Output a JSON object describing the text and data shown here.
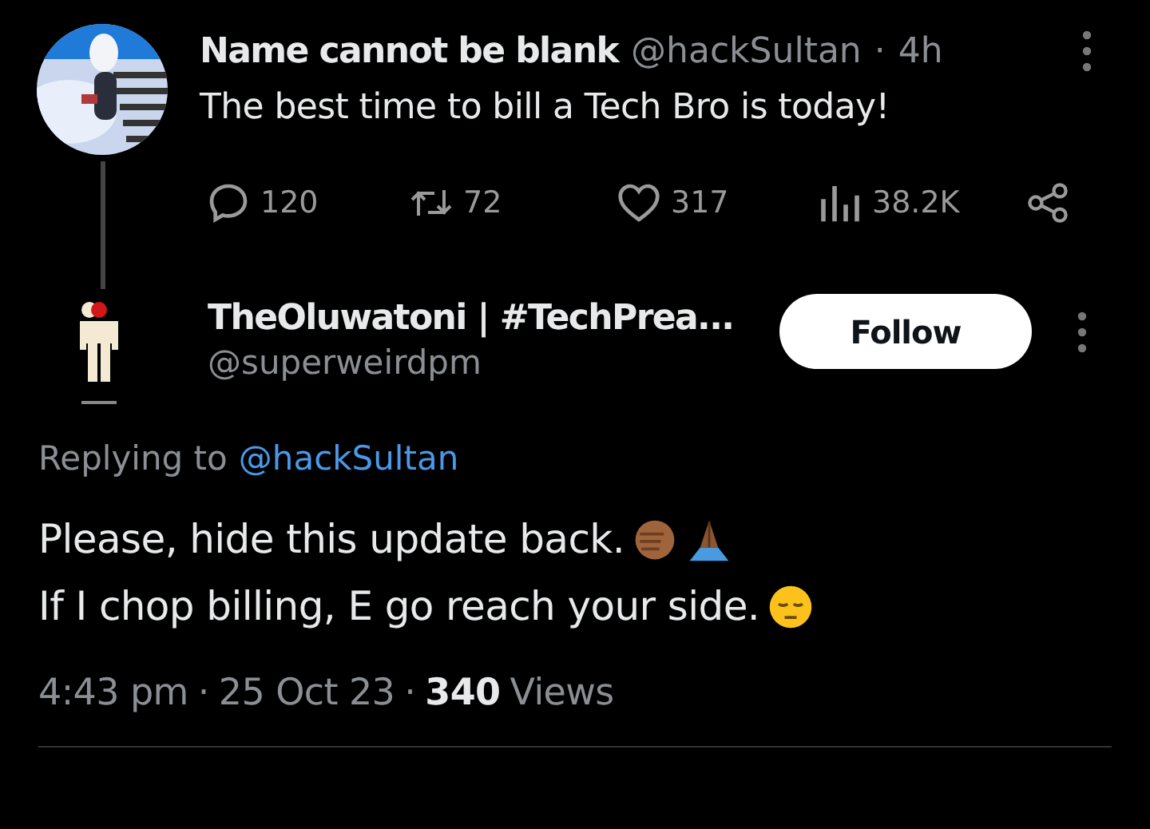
{
  "parent_tweet": {
    "author_name": "Name cannot be blank",
    "handle": "@hackSultan",
    "separator": "·",
    "time": "4h",
    "text": "The best time to bill a Tech Bro is today!",
    "actions": [
      {
        "kind": "reply",
        "count": "120"
      },
      {
        "kind": "retweet",
        "count": "72"
      },
      {
        "kind": "like",
        "count": "317"
      },
      {
        "kind": "views",
        "count": "38.2K"
      },
      {
        "kind": "share"
      }
    ]
  },
  "reply_tweet": {
    "author_name": "TheOluwatoni | #TechPrea...",
    "handle": "@superweirdpm",
    "follow_button": "Follow",
    "replying_prefix": "Replying to",
    "replying_handle": "@hackSultan",
    "lines": [
      {
        "text": "Please, hide this update back.",
        "emojis": [
          {
            "kind": "fist"
          },
          {
            "kind": "pray"
          }
        ]
      },
      {
        "text": "If I chop billing, E go reach your side.",
        "emojis": [
          {
            "kind": "pensive"
          }
        ]
      }
    ],
    "time": "4:43 pm",
    "sep1": "·",
    "date": "25 Oct 23",
    "sep2": "·",
    "views_count": "340",
    "views_label": "Views"
  }
}
